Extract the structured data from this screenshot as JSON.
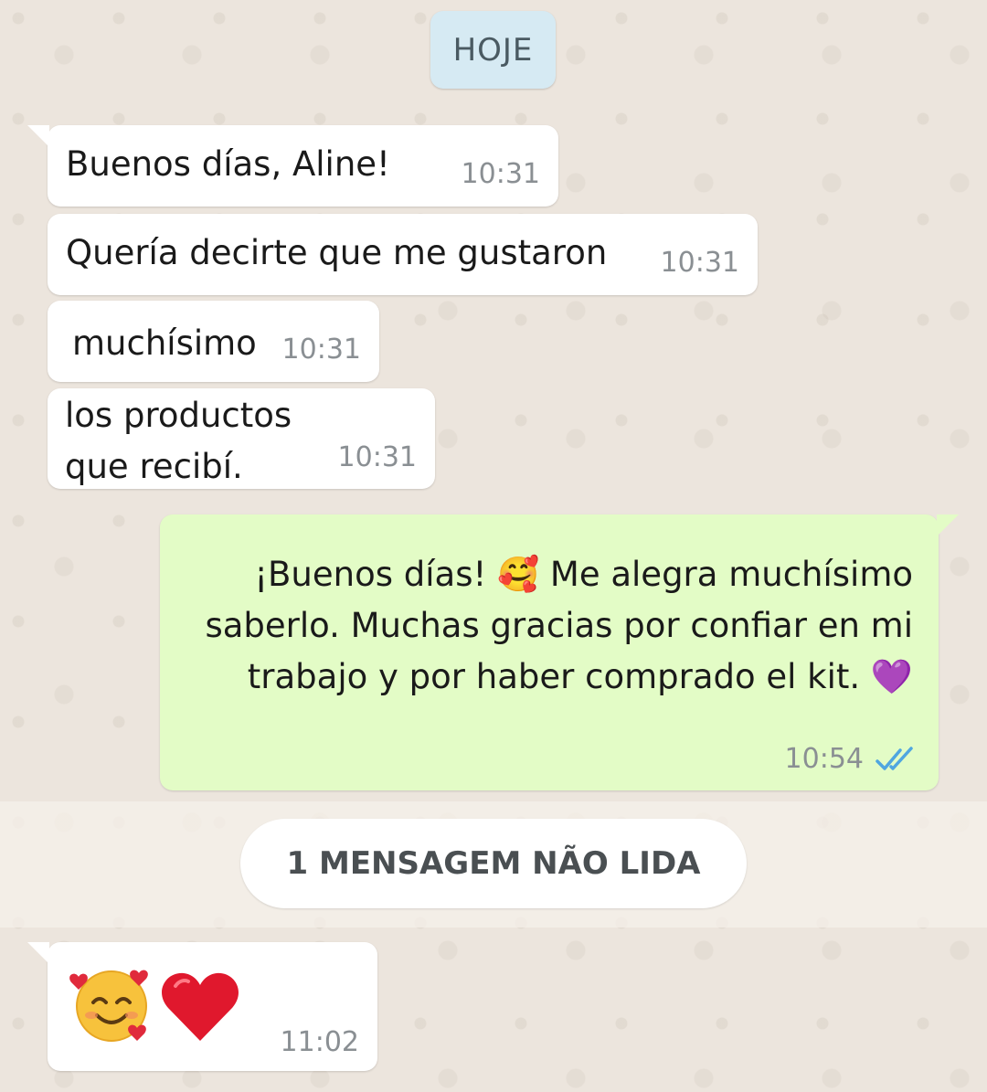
{
  "chat": {
    "date_separator": "HOJE",
    "unread_banner": "1 MENSAGEM NÃO LIDA",
    "incoming": [
      {
        "lines": [
          "Buenos días, Aline!"
        ],
        "time": "10:31"
      },
      {
        "lines": [
          "Quería decirte que me gustaron"
        ],
        "time": "10:31"
      },
      {
        "lines": [
          "muchísimo"
        ],
        "time": "10:31"
      },
      {
        "lines": [
          "los productos",
          "que recibí."
        ],
        "time": "10:31"
      }
    ],
    "outgoing": {
      "lines": [
        "¡Buenos días! 🥰 Me alegra muchísimo",
        "saberlo. Muchas gracias por confiar en mi",
        "trabajo y por haber comprado el kit. 💜"
      ],
      "time": "10:54",
      "status_icon": "double-check-read-icon",
      "status_color": "#4fa6e0"
    },
    "last_incoming": {
      "emojis": [
        "smiling-face-with-hearts-icon",
        "red-heart-icon"
      ],
      "time": "11:02"
    }
  },
  "colors": {
    "wallpaper": "#ece5dd",
    "incoming_bubble": "#ffffff",
    "outgoing_bubble": "#e3fcc6",
    "date_chip": "#d6eaf3",
    "timestamp": "#8a8f93"
  }
}
